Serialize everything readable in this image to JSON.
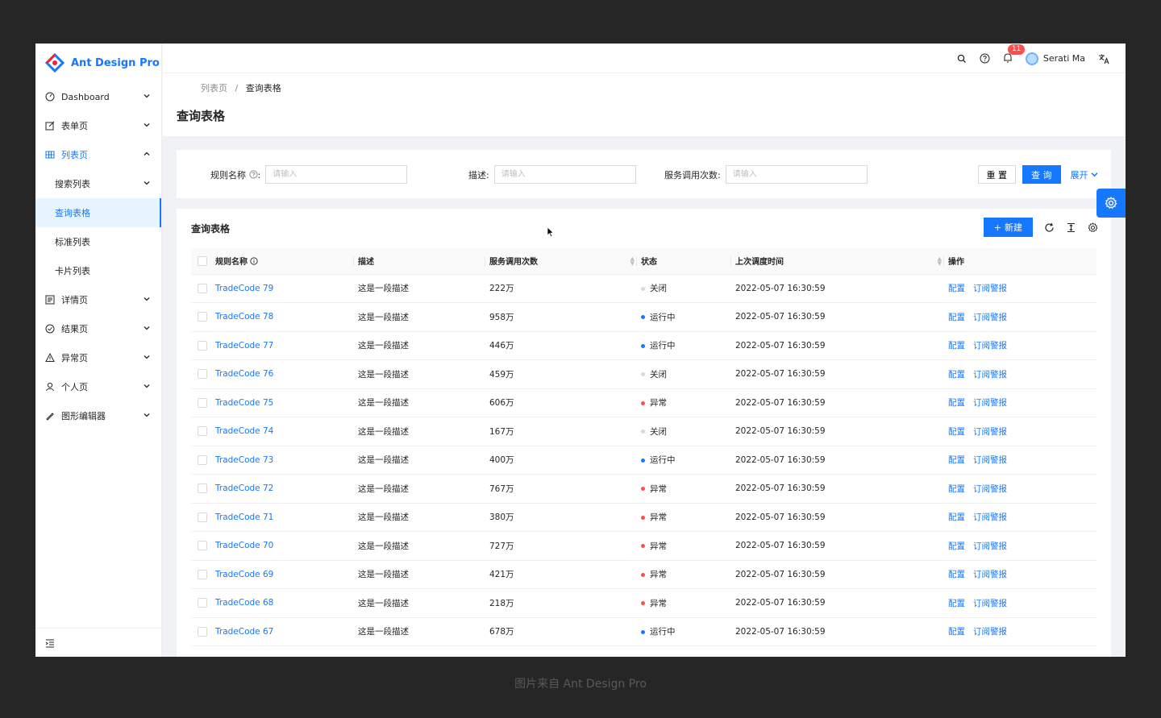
{
  "app": {
    "name": "Ant Design Pro"
  },
  "sidebar": {
    "items": [
      {
        "label": "Dashboard",
        "icon": "dashboard-icon"
      },
      {
        "label": "表单页",
        "icon": "form-icon"
      },
      {
        "label": "列表页",
        "icon": "table-icon"
      },
      {
        "label": "搜索列表"
      },
      {
        "label": "查询表格"
      },
      {
        "label": "标准列表"
      },
      {
        "label": "卡片列表"
      },
      {
        "label": "详情页",
        "icon": "profile-icon"
      },
      {
        "label": "结果页",
        "icon": "check-circle-icon"
      },
      {
        "label": "异常页",
        "icon": "warning-icon"
      },
      {
        "label": "个人页",
        "icon": "user-icon"
      },
      {
        "label": "图形编辑器",
        "icon": "highlight-icon"
      }
    ]
  },
  "header": {
    "notification_count": "11",
    "user_name": "Serati Ma"
  },
  "breadcrumb": {
    "parent": "列表页",
    "sep": "/",
    "current": "查询表格"
  },
  "page": {
    "title": "查询表格"
  },
  "search": {
    "rule_label": "规则名称",
    "desc_label": "描述",
    "calls_label": "服务调用次数",
    "placeholder": "请输入",
    "reset": "重 置",
    "query": "查 询",
    "expand": "展开"
  },
  "table": {
    "title": "查询表格",
    "new_button": "新建",
    "columns": [
      "规则名称",
      "描述",
      "服务调用次数",
      "状态",
      "上次调度时间",
      "操作"
    ],
    "actions": [
      "配置",
      "订阅警报"
    ],
    "rows": [
      {
        "name": "TradeCode 79",
        "desc": "这是一段描述",
        "calls": "222万",
        "status": "关闭",
        "time": "2022-05-07 16:30:59"
      },
      {
        "name": "TradeCode 78",
        "desc": "这是一段描述",
        "calls": "958万",
        "status": "运行中",
        "time": "2022-05-07 16:30:59"
      },
      {
        "name": "TradeCode 77",
        "desc": "这是一段描述",
        "calls": "446万",
        "status": "运行中",
        "time": "2022-05-07 16:30:59"
      },
      {
        "name": "TradeCode 76",
        "desc": "这是一段描述",
        "calls": "459万",
        "status": "关闭",
        "time": "2022-05-07 16:30:59"
      },
      {
        "name": "TradeCode 75",
        "desc": "这是一段描述",
        "calls": "606万",
        "status": "异常",
        "time": "2022-05-07 16:30:59"
      },
      {
        "name": "TradeCode 74",
        "desc": "这是一段描述",
        "calls": "167万",
        "status": "关闭",
        "time": "2022-05-07 16:30:59"
      },
      {
        "name": "TradeCode 73",
        "desc": "这是一段描述",
        "calls": "400万",
        "status": "运行中",
        "time": "2022-05-07 16:30:59"
      },
      {
        "name": "TradeCode 72",
        "desc": "这是一段描述",
        "calls": "767万",
        "status": "异常",
        "time": "2022-05-07 16:30:59"
      },
      {
        "name": "TradeCode 71",
        "desc": "这是一段描述",
        "calls": "380万",
        "status": "异常",
        "time": "2022-05-07 16:30:59"
      },
      {
        "name": "TradeCode 70",
        "desc": "这是一段描述",
        "calls": "727万",
        "status": "异常",
        "time": "2022-05-07 16:30:59"
      },
      {
        "name": "TradeCode 69",
        "desc": "这是一段描述",
        "calls": "421万",
        "status": "异常",
        "time": "2022-05-07 16:30:59"
      },
      {
        "name": "TradeCode 68",
        "desc": "这是一段描述",
        "calls": "218万",
        "status": "异常",
        "time": "2022-05-07 16:30:59"
      },
      {
        "name": "TradeCode 67",
        "desc": "这是一段描述",
        "calls": "678万",
        "status": "运行中",
        "time": "2022-05-07 16:30:59"
      }
    ]
  },
  "status_colors": {
    "关闭": "#d9d9d9",
    "运行中": "#1677ff",
    "异常": "#ff4d4f"
  },
  "colors": {
    "primary": "#1677ff"
  },
  "caption": "图片来自 Ant Design Pro"
}
